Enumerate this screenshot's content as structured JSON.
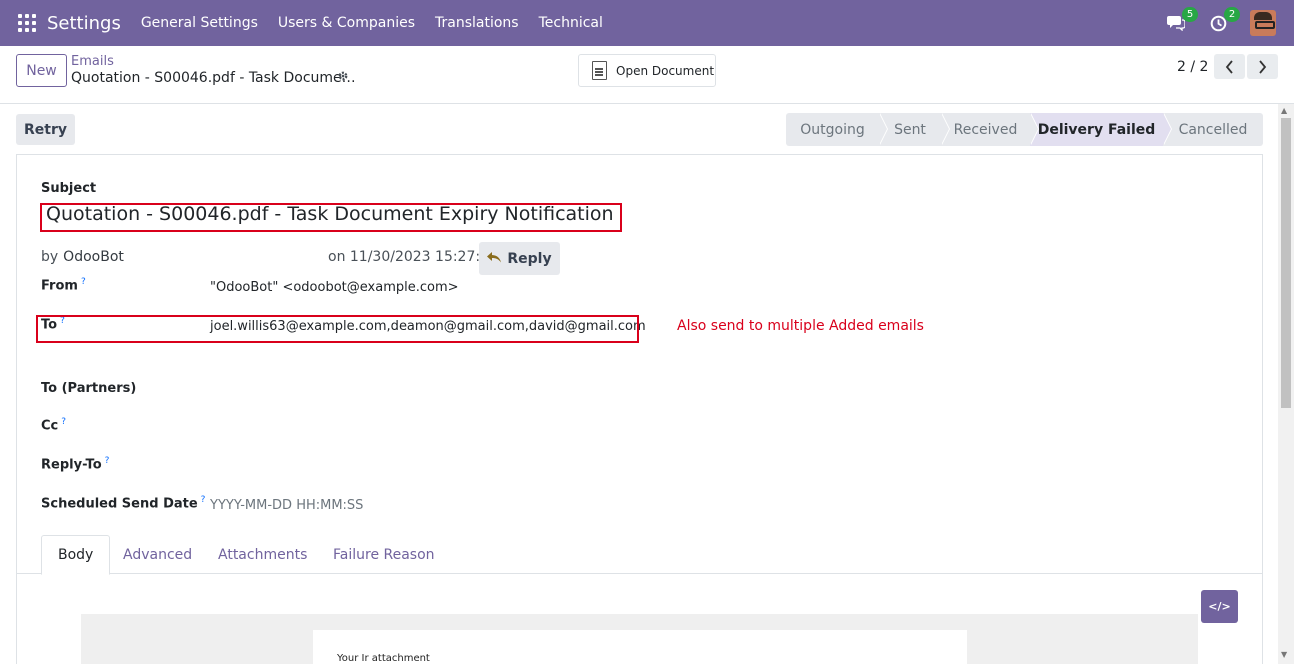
{
  "navbar": {
    "app_name": "Settings",
    "menu": [
      "General Settings",
      "Users & Companies",
      "Translations",
      "Technical"
    ],
    "messages_count": "5",
    "activities_count": "2"
  },
  "control_panel": {
    "new_label": "New",
    "breadcrumb_parent": "Emails",
    "breadcrumb_current": "Quotation - S00046.pdf - Task Docume…",
    "open_document_label": "Open Document",
    "pager": "2 / 2"
  },
  "status": {
    "retry_label": "Retry",
    "stages": [
      "Outgoing",
      "Sent",
      "Received",
      "Delivery Failed",
      "Cancelled"
    ],
    "active_stage": "Delivery Failed"
  },
  "form": {
    "subject_label": "Subject",
    "subject": "Quotation - S00046.pdf - Task Document Expiry Notification",
    "by_label": "by",
    "author": "OdooBot",
    "date": "on 11/30/2023 15:27:27",
    "reply_label": "Reply",
    "from_label": "From",
    "from_value": "\"OdooBot\" <odoobot@example.com>",
    "to_label": "To",
    "to_value": "joel.willis63@example.com,deamon@gmail.com,david@gmail.com",
    "to_partners_label": "To (Partners)",
    "cc_label": "Cc",
    "reply_to_label": "Reply-To",
    "scheduled_label": "Scheduled Send Date",
    "scheduled_placeholder": "YYYY-MM-DD HH:MM:SS",
    "help_mark": "?"
  },
  "annotation": "Also send to multiple Added emails",
  "tabs": [
    "Body",
    "Advanced",
    "Attachments",
    "Failure Reason"
  ],
  "body": {
    "code_button_label": "</>",
    "preview_text": "Your Ir attachment"
  },
  "colors": {
    "brand": "#71639e",
    "annotation_red": "#d9001b",
    "badge_green": "#28a745"
  }
}
